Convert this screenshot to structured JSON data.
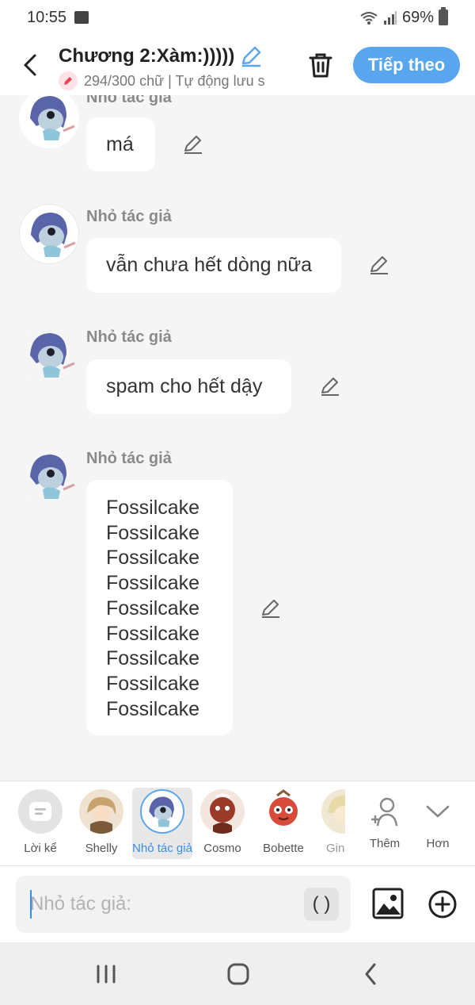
{
  "status_bar": {
    "time": "10:55",
    "battery": "69%"
  },
  "header": {
    "title": "Chương 2:Xàm:)))))",
    "subtitle": "294/300 chữ | Tự động lưu s",
    "next_label": "Tiếp theo"
  },
  "messages": [
    {
      "speaker": "Nhỏ tác giả",
      "text": "má"
    },
    {
      "speaker": "Nhỏ tác giả",
      "text": "vẫn chưa hết dòng nữa"
    },
    {
      "speaker": "Nhỏ tác giả",
      "text": "spam cho hết dậy"
    },
    {
      "speaker": "Nhỏ tác giả",
      "lines": [
        "Fossilcake",
        "Fossilcake",
        "Fossilcake",
        "Fossilcake",
        "Fossilcake",
        "Fossilcake",
        "Fossilcake",
        "Fossilcake",
        "Fossilcake"
      ]
    }
  ],
  "characters": [
    {
      "label": "Lời kể",
      "icon": "narration-icon"
    },
    {
      "label": "Shelly",
      "icon": "avatar"
    },
    {
      "label": "Nhỏ tác giả",
      "icon": "avatar",
      "selected": true
    },
    {
      "label": "Cosmo",
      "icon": "avatar"
    },
    {
      "label": "Bobette",
      "icon": "avatar"
    },
    {
      "label": "Gin",
      "icon": "avatar"
    },
    {
      "label": "Thêm",
      "icon": "add-character-icon"
    },
    {
      "label": "Hơn",
      "icon": "chevron-down-icon"
    }
  ],
  "input": {
    "placeholder": "Nhỏ tác giả:",
    "paren_label": "( )"
  },
  "colors": {
    "accent": "#5aa6ee",
    "selected_text": "#3a8ee6"
  }
}
